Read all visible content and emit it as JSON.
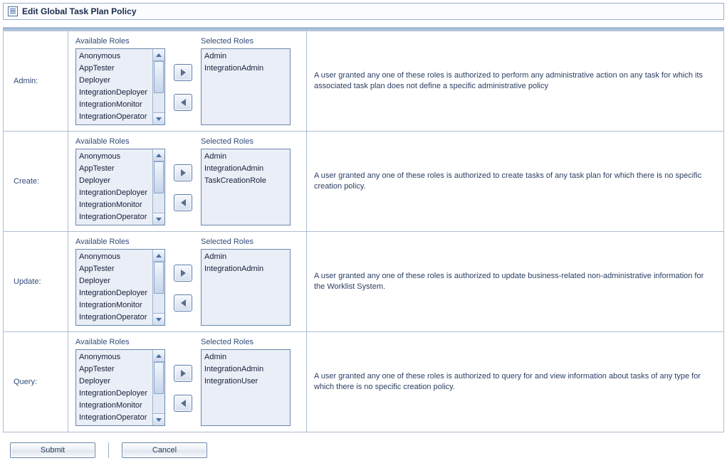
{
  "header": {
    "title": "Edit Global Task Plan Policy"
  },
  "labels": {
    "available": "Available Roles",
    "selected": "Selected Roles"
  },
  "availableRolesList": [
    "Anonymous",
    "AppTester",
    "Deployer",
    "IntegrationDeployer",
    "IntegrationMonitor",
    "IntegrationOperator"
  ],
  "rows": [
    {
      "id": "admin",
      "label": "Admin:",
      "selected": [
        "Admin",
        "IntegrationAdmin"
      ],
      "description": "A user granted any one of these roles is authorized to perform any administrative action on any task for which its associated task plan does not define a specific administrative policy"
    },
    {
      "id": "create",
      "label": "Create:",
      "selected": [
        "Admin",
        "IntegrationAdmin",
        "TaskCreationRole"
      ],
      "description": "A user granted any one of these roles is authorized to create tasks of any task plan for which there is no specific creation policy."
    },
    {
      "id": "update",
      "label": "Update:",
      "selected": [
        "Admin",
        "IntegrationAdmin"
      ],
      "description": "A user granted any one of these roles is authorized to update business-related non-administrative information for the Worklist System."
    },
    {
      "id": "query",
      "label": "Query:",
      "selected": [
        "Admin",
        "IntegrationAdmin",
        "IntegrationUser"
      ],
      "description": "A user granted any one of these roles is authorized to query for and view information about tasks of any type for which there is no specific creation policy."
    }
  ],
  "footer": {
    "submit": "Submit",
    "cancel": "Cancel"
  }
}
